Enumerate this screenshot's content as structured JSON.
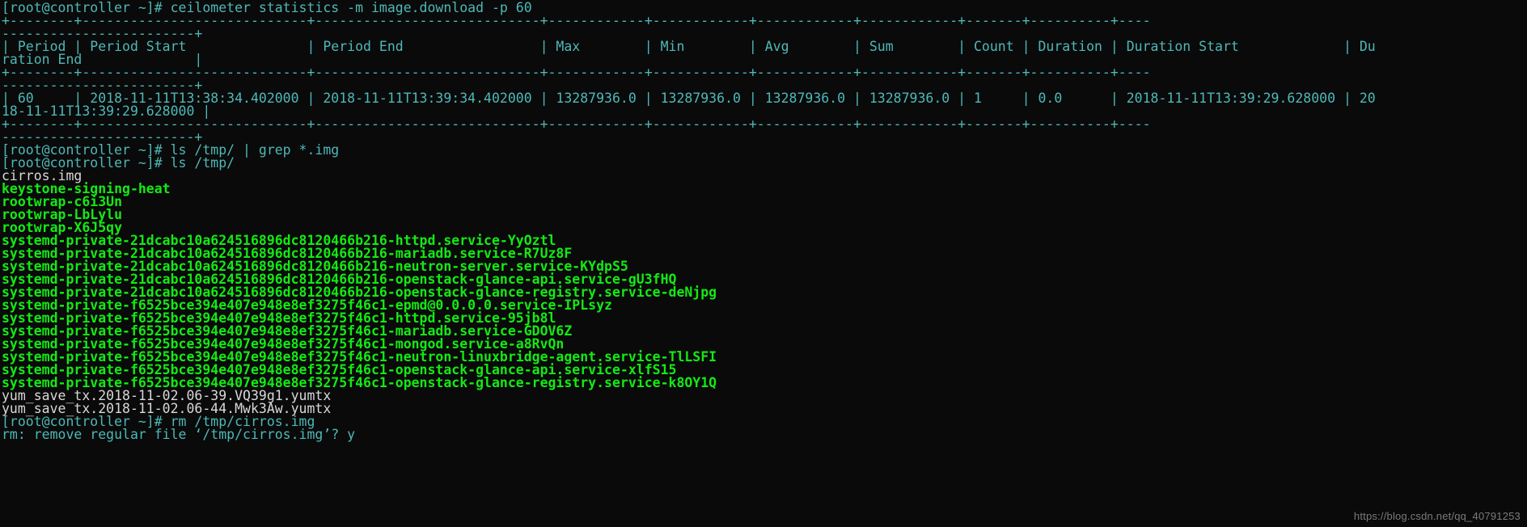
{
  "terminal": {
    "window_title": "root@controller:~",
    "prompt": "[root@controller ~]#",
    "colors": {
      "background": "#0a0a0a",
      "cyan": "#4fb8b8",
      "white": "#d8d8d8",
      "green_bold": "#13ea13",
      "watermark": "#7b7b7b"
    },
    "commands": [
      "ceilometer statistics -m image.download -p 60",
      "ls /tmp/ | grep *.img",
      "ls /tmp/",
      "rm /tmp/cirros.img"
    ],
    "table": {
      "headers": [
        "Period",
        "Period Start",
        "Period End",
        "Max",
        "Min",
        "Avg",
        "Sum",
        "Count",
        "Duration",
        "Duration Start",
        "Duration End"
      ],
      "rows": [
        {
          "Period": "60",
          "Period Start": "2018-11-11T13:38:34.402000",
          "Period End": "2018-11-11T13:39:34.402000",
          "Max": "13287936.0",
          "Min": "13287936.0",
          "Avg": "13287936.0",
          "Sum": "13287936.0",
          "Count": "1",
          "Duration": "0.0",
          "Duration Start": "2018-11-11T13:39:29.628000",
          "Duration End": "2018-11-11T13:39:29.628000"
        }
      ]
    },
    "tmp_listing": [
      {
        "name": "cirros.img",
        "type": "file"
      },
      {
        "name": "keystone-signing-heat",
        "type": "dir"
      },
      {
        "name": "rootwrap-c6i3Un",
        "type": "dir"
      },
      {
        "name": "rootwrap-LbLylu",
        "type": "dir"
      },
      {
        "name": "rootwrap-X6J5qy",
        "type": "dir"
      },
      {
        "name": "systemd-private-21dcabc10a624516896dc8120466b216-httpd.service-YyOztl",
        "type": "dir"
      },
      {
        "name": "systemd-private-21dcabc10a624516896dc8120466b216-mariadb.service-R7Uz8F",
        "type": "dir"
      },
      {
        "name": "systemd-private-21dcabc10a624516896dc8120466b216-neutron-server.service-KYdpS5",
        "type": "dir"
      },
      {
        "name": "systemd-private-21dcabc10a624516896dc8120466b216-openstack-glance-api.service-gU3fHQ",
        "type": "dir"
      },
      {
        "name": "systemd-private-21dcabc10a624516896dc8120466b216-openstack-glance-registry.service-deNjpg",
        "type": "dir"
      },
      {
        "name": "systemd-private-f6525bce394e407e948e8ef3275f46c1-epmd@0.0.0.0.service-IPLsyz",
        "type": "dir"
      },
      {
        "name": "systemd-private-f6525bce394e407e948e8ef3275f46c1-httpd.service-95jb8l",
        "type": "dir"
      },
      {
        "name": "systemd-private-f6525bce394e407e948e8ef3275f46c1-mariadb.service-GDOV6Z",
        "type": "dir"
      },
      {
        "name": "systemd-private-f6525bce394e407e948e8ef3275f46c1-mongod.service-a8RvQn",
        "type": "dir"
      },
      {
        "name": "systemd-private-f6525bce394e407e948e8ef3275f46c1-neutron-linuxbridge-agent.service-TlLSFI",
        "type": "dir"
      },
      {
        "name": "systemd-private-f6525bce394e407e948e8ef3275f46c1-openstack-glance-api.service-xlfS15",
        "type": "dir"
      },
      {
        "name": "systemd-private-f6525bce394e407e948e8ef3275f46c1-openstack-glance-registry.service-k8OY1Q",
        "type": "dir"
      },
      {
        "name": "yum_save_tx.2018-11-02.06-39.VQ39g1.yumtx",
        "type": "file"
      },
      {
        "name": "yum_save_tx.2018-11-02.06-44.Mwk3Aw.yumtx",
        "type": "file"
      }
    ],
    "rm_confirm": "rm: remove regular file ‘/tmp/cirros.img’? y",
    "lines": [
      {
        "id": "l01",
        "color": "cyan",
        "text": "[root@controller ~]# ceilometer statistics -m image.download -p 60"
      },
      {
        "id": "l02",
        "color": "cyan",
        "text": "+--------+----------------------------+----------------------------+------------+------------+------------+------------+-------+----------+----"
      },
      {
        "id": "l03",
        "color": "cyan",
        "text": "------------------------+"
      },
      {
        "id": "l04",
        "color": "cyan",
        "text": "| Period | Period Start               | Period End                 | Max        | Min        | Avg        | Sum        | Count | Duration | Duration Start             | Du"
      },
      {
        "id": "l05",
        "color": "cyan",
        "text": "ration End              |"
      },
      {
        "id": "l06",
        "color": "cyan",
        "text": "+--------+----------------------------+----------------------------+------------+------------+------------+------------+-------+----------+----"
      },
      {
        "id": "l07",
        "color": "cyan",
        "text": "------------------------+"
      },
      {
        "id": "l08",
        "color": "cyan",
        "text": "| 60     | 2018-11-11T13:38:34.402000 | 2018-11-11T13:39:34.402000 | 13287936.0 | 13287936.0 | 13287936.0 | 13287936.0 | 1     | 0.0      | 2018-11-11T13:39:29.628000 | 20"
      },
      {
        "id": "l09",
        "color": "cyan",
        "text": "18-11-11T13:39:29.628000 |"
      },
      {
        "id": "l10",
        "color": "cyan",
        "text": "+--------+----------------------------+----------------------------+------------+------------+------------+------------+-------+----------+----"
      },
      {
        "id": "l11",
        "color": "cyan",
        "text": "------------------------+"
      },
      {
        "id": "l12",
        "color": "cyan",
        "text": "[root@controller ~]# ls /tmp/ | grep *.img"
      },
      {
        "id": "l13",
        "color": "cyan",
        "text": "[root@controller ~]# ls /tmp/"
      },
      {
        "id": "l14",
        "color": "white",
        "text": "cirros.img"
      },
      {
        "id": "l15",
        "color": "green",
        "text": "keystone-signing-heat"
      },
      {
        "id": "l16",
        "color": "green",
        "text": "rootwrap-c6i3Un"
      },
      {
        "id": "l17",
        "color": "green",
        "text": "rootwrap-LbLylu"
      },
      {
        "id": "l18",
        "color": "green",
        "text": "rootwrap-X6J5qy"
      },
      {
        "id": "l19",
        "color": "green",
        "text": "systemd-private-21dcabc10a624516896dc8120466b216-httpd.service-YyOztl"
      },
      {
        "id": "l20",
        "color": "green",
        "text": "systemd-private-21dcabc10a624516896dc8120466b216-mariadb.service-R7Uz8F"
      },
      {
        "id": "l21",
        "color": "green",
        "text": "systemd-private-21dcabc10a624516896dc8120466b216-neutron-server.service-KYdpS5"
      },
      {
        "id": "l22",
        "color": "green",
        "text": "systemd-private-21dcabc10a624516896dc8120466b216-openstack-glance-api.service-gU3fHQ"
      },
      {
        "id": "l23",
        "color": "green",
        "text": "systemd-private-21dcabc10a624516896dc8120466b216-openstack-glance-registry.service-deNjpg"
      },
      {
        "id": "l24",
        "color": "green",
        "text": "systemd-private-f6525bce394e407e948e8ef3275f46c1-epmd@0.0.0.0.service-IPLsyz"
      },
      {
        "id": "l25",
        "color": "green",
        "text": "systemd-private-f6525bce394e407e948e8ef3275f46c1-httpd.service-95jb8l"
      },
      {
        "id": "l26",
        "color": "green",
        "text": "systemd-private-f6525bce394e407e948e8ef3275f46c1-mariadb.service-GDOV6Z"
      },
      {
        "id": "l27",
        "color": "green",
        "text": "systemd-private-f6525bce394e407e948e8ef3275f46c1-mongod.service-a8RvQn"
      },
      {
        "id": "l28",
        "color": "green",
        "text": "systemd-private-f6525bce394e407e948e8ef3275f46c1-neutron-linuxbridge-agent.service-TlLSFI"
      },
      {
        "id": "l29",
        "color": "green",
        "text": "systemd-private-f6525bce394e407e948e8ef3275f46c1-openstack-glance-api.service-xlfS15"
      },
      {
        "id": "l30",
        "color": "green",
        "text": "systemd-private-f6525bce394e407e948e8ef3275f46c1-openstack-glance-registry.service-k8OY1Q"
      },
      {
        "id": "l31",
        "color": "white",
        "text": "yum_save_tx.2018-11-02.06-39.VQ39g1.yumtx"
      },
      {
        "id": "l32",
        "color": "white",
        "text": "yum_save_tx.2018-11-02.06-44.Mwk3Aw.yumtx"
      },
      {
        "id": "l33",
        "color": "cyan",
        "text": "[root@controller ~]# rm /tmp/cirros.img"
      },
      {
        "id": "l34",
        "color": "cyan",
        "text": "rm: remove regular file ‘/tmp/cirros.img’? y"
      }
    ]
  },
  "watermark": {
    "text": "https://blog.csdn.net/qq_40791253"
  }
}
